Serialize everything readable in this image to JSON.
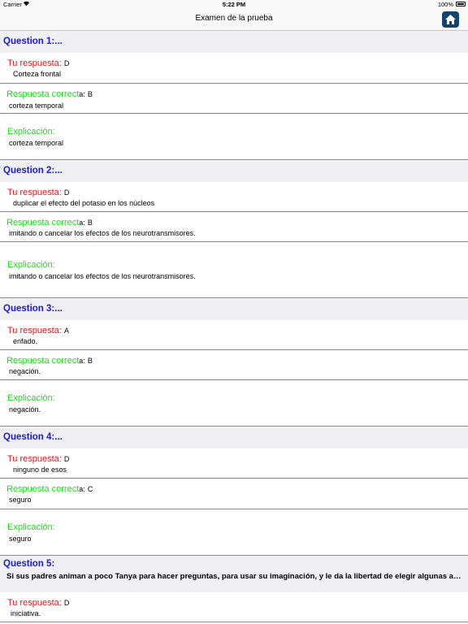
{
  "status_bar": {
    "carrier": "Carrier",
    "time": "5:22 PM",
    "battery": "100%"
  },
  "nav": {
    "title": "Examen de la prueba"
  },
  "labels": {
    "your_answer": "Tu respuesta:",
    "correct_answer": "Respuesta correct",
    "correct_answer_suffix": "a:",
    "explanation": "Explicación:",
    "explanation_suffix": ":"
  },
  "questions": [
    {
      "header": "Question 1:...",
      "your_letter": "D",
      "your_text": "Corteza frontal",
      "correct_letter": "B",
      "correct_text": "corteza temporal",
      "explanation_text": "corteza temporal"
    },
    {
      "header": "Question 2:...",
      "your_letter": "D",
      "your_text": "duplicar el efecto del potasio en los núcleos",
      "correct_letter": "B",
      "correct_text": "imitando o cancelar los efectos de los neurotransmisores.",
      "explanation_text": "imitando o cancelar los efectos de los neurotransmisores."
    },
    {
      "header": "Question 3:...",
      "your_letter": "A",
      "your_text": "enfado.",
      "correct_letter": "B",
      "correct_text": "negación.",
      "explanation_text": "negación."
    },
    {
      "header": "Question 4:...",
      "your_letter": "D",
      "your_text": "ninguno de esos",
      "correct_letter": "C",
      "correct_text": "seguro",
      "explanation_text": "seguro"
    },
    {
      "header": "Question 5:",
      "question_text": "Si sus padres animan a poco Tanya para hacer preguntas, para usar su imaginación, y le da la libertad de elegir algunas activi...",
      "your_letter": "D",
      "your_text": "iniciativa."
    }
  ]
}
